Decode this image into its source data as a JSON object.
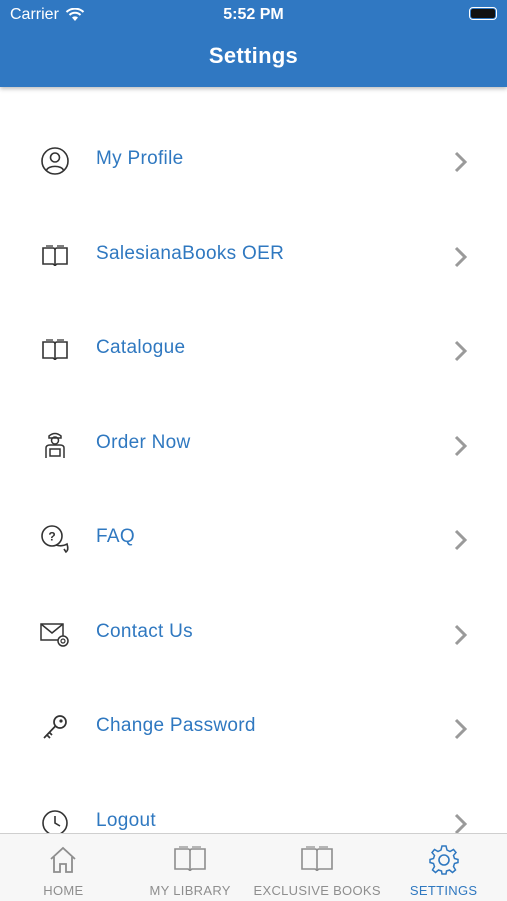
{
  "status_bar": {
    "carrier": "Carrier",
    "time": "5:52 PM"
  },
  "header": {
    "title": "Settings"
  },
  "menu": [
    {
      "label": "My Profile",
      "icon": "user-icon"
    },
    {
      "label": "SalesianaBooks OER",
      "icon": "book-icon"
    },
    {
      "label": "Catalogue",
      "icon": "book-icon"
    },
    {
      "label": "Order Now",
      "icon": "delivery-person-icon"
    },
    {
      "label": "FAQ",
      "icon": "faq-chat-icon"
    },
    {
      "label": "Contact Us",
      "icon": "mail-icon"
    },
    {
      "label": "Change Password",
      "icon": "key-icon"
    },
    {
      "label": "Logout",
      "icon": "logout-icon"
    }
  ],
  "tabs": [
    {
      "label": "HOME",
      "icon": "home-icon",
      "active": false
    },
    {
      "label": "MY LIBRARY",
      "icon": "book-icon",
      "active": false
    },
    {
      "label": "EXCLUSIVE BOOKS",
      "icon": "book-icon",
      "active": false
    },
    {
      "label": "SETTINGS",
      "icon": "gear-icon",
      "active": true
    }
  ],
  "colors": {
    "accent": "#2f78c0",
    "header_bg": "#3078c2",
    "chevron": "#9a9a9a",
    "tab_inactive": "#8e8e8e"
  }
}
